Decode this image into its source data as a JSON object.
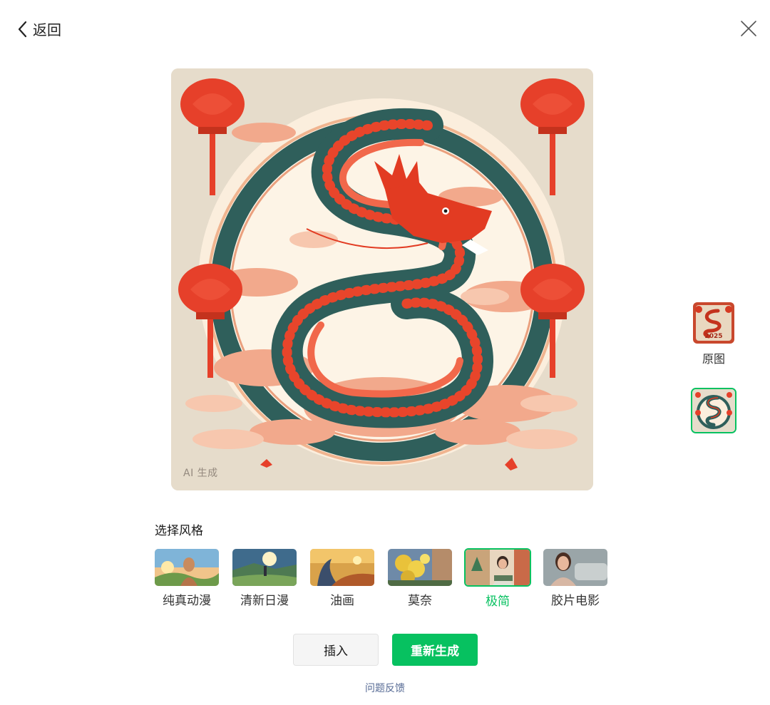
{
  "nav": {
    "back_label": "返回"
  },
  "preview": {
    "ai_tag": "AI 生成"
  },
  "versions": [
    {
      "label": "原图",
      "text": "2025"
    },
    {
      "label": ""
    }
  ],
  "style_section": {
    "title": "选择风格",
    "styles": [
      {
        "label": "纯真动漫"
      },
      {
        "label": "清新日漫"
      },
      {
        "label": "油画"
      },
      {
        "label": "莫奈"
      },
      {
        "label": "极简",
        "selected": true
      },
      {
        "label": "胶片电影"
      }
    ]
  },
  "actions": {
    "insert_label": "插入",
    "regenerate_label": "重新生成"
  },
  "feedback_label": "问题反馈",
  "colors": {
    "accent": "#07c160",
    "link": "#576b95"
  }
}
